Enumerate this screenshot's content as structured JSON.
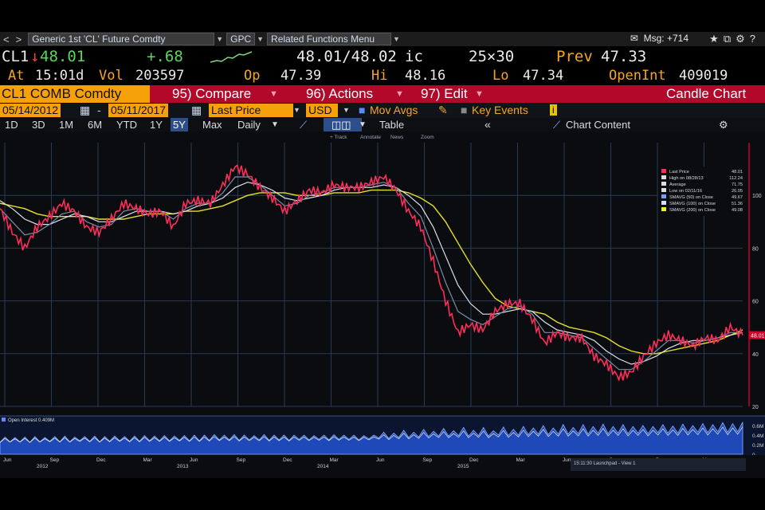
{
  "toolbar": {
    "back_glyph": "<",
    "fwd_glyph": ">",
    "security": "Generic 1st 'CL' Future Comdty",
    "function": "GPC",
    "related": "Related Functions Menu",
    "msg": "Msg: +714",
    "icons": [
      "mail-icon",
      "star-icon",
      "export-icon",
      "settings-icon",
      "help-icon"
    ]
  },
  "quote": {
    "ticker": "CL1",
    "arrow": "↓",
    "last": "48.01",
    "change": "+.68",
    "bid_ask": "48.01/48.02",
    "bid_ask_suffix": "ic",
    "size": "25×30",
    "prev_label": "Prev",
    "prev": "47.33",
    "at_label": "At",
    "time": "15:01d",
    "vol_label": "Vol",
    "vol": "203597",
    "op_label": "Op",
    "op": "47.39",
    "hi_label": "Hi",
    "hi": "48.16",
    "lo_label": "Lo",
    "lo": "47.34",
    "oi_label": "OpenInt",
    "oi": "409019"
  },
  "menu": {
    "ticker": "CL1 COMB Comdty",
    "compare": "95) Compare",
    "actions": "96) Actions",
    "edit": "97) Edit",
    "chart_type": "Candle Chart"
  },
  "options": {
    "start": "05/14/2012",
    "end": "05/11/2017",
    "field": "Last Price",
    "currency": "USD",
    "mov_avgs": "Mov Avgs",
    "key_events": "Key Events"
  },
  "ranges": {
    "items": [
      "1D",
      "3D",
      "1M",
      "6M",
      "YTD",
      "1Y",
      "5Y",
      "Max"
    ],
    "selected": "5Y",
    "period": "Daily",
    "table": "Table",
    "chart_content": "Chart Content"
  },
  "tools": [
    "+ Track",
    "Annotate",
    "News",
    "Zoom"
  ],
  "legend": [
    {
      "label": "Last Price",
      "value": "48.01",
      "color": "#ff2d5a"
    },
    {
      "label": "High on 08/28/13",
      "value": "112.24",
      "color": "#dddddd"
    },
    {
      "label": "Average",
      "value": "71.75",
      "color": "#dddddd"
    },
    {
      "label": "Low on 02/11/16",
      "value": "26.05",
      "color": "#dddddd"
    },
    {
      "label": "SMAVG (50) on Close",
      "value": "49.67",
      "color": "#7aa0ff"
    },
    {
      "label": "SMAVG (100) on Close",
      "value": "51.36",
      "color": "#cfe2ff"
    },
    {
      "label": "SMAVG (200) on Close",
      "value": "49.08",
      "color": "#f0f020"
    }
  ],
  "colors": {
    "price": "#ff2d5a",
    "ma50": "#7a8ca8",
    "ma100": "#d9e4ee",
    "ma200": "#e8e02a",
    "menubar": "#b2082a",
    "ticker_box": "#f7a10a",
    "oi_fill": "#1f49b8"
  },
  "chart_data": {
    "type": "line",
    "ylim": [
      20,
      120
    ],
    "y_ticks": [
      20,
      40,
      60,
      80,
      100
    ],
    "x_month_labels": [
      "Jun",
      "Sep",
      "Dec",
      "Mar",
      "Jun",
      "Sep",
      "Dec",
      "Mar",
      "Jun",
      "Sep",
      "Dec",
      "Mar",
      "Jun",
      "Sep",
      "Dec",
      "Mar"
    ],
    "x_year_labels": [
      "2012",
      "2013",
      "2014",
      "2015"
    ],
    "last_price_tag": "48.01",
    "x": [
      0,
      1,
      2,
      3,
      4,
      5,
      6,
      7,
      8,
      9,
      10,
      11,
      12,
      13,
      14,
      15,
      16,
      17,
      18,
      19,
      20,
      21,
      22,
      23,
      24,
      25,
      26,
      27,
      28,
      29,
      30,
      31,
      32,
      33,
      34,
      35,
      36,
      37,
      38,
      39,
      40,
      41,
      42,
      43,
      44,
      45,
      46,
      47,
      48,
      49,
      50,
      51,
      52,
      53,
      54,
      55,
      56,
      57,
      58,
      59,
      60
    ],
    "series": [
      {
        "name": "Last Price",
        "values": [
          95,
          86,
          80,
          88,
          92,
          97,
          94,
          88,
          86,
          91,
          97,
          95,
          93,
          94,
          88,
          97,
          98,
          97,
          104,
          111,
          108,
          103,
          99,
          94,
          98,
          102,
          101,
          104,
          103,
          103,
          105,
          107,
          102,
          94,
          88,
          75,
          60,
          48,
          51,
          49,
          56,
          59,
          59,
          53,
          44,
          48,
          46,
          46,
          39,
          36,
          31,
          33,
          39,
          44,
          47,
          45,
          43,
          46,
          45,
          50,
          47
        ]
      },
      {
        "name": "SMAVG (50) on Close",
        "values": [
          95,
          90,
          85,
          86,
          89,
          93,
          94,
          90,
          88,
          89,
          94,
          95,
          94,
          94,
          91,
          95,
          97,
          97,
          101,
          107,
          107,
          104,
          100,
          96,
          97,
          100,
          101,
          103,
          103,
          103,
          104,
          105,
          103,
          97,
          92,
          80,
          67,
          56,
          53,
          51,
          54,
          57,
          58,
          55,
          48,
          48,
          47,
          46,
          42,
          38,
          34,
          34,
          37,
          41,
          45,
          45,
          44,
          45,
          46,
          48,
          48
        ]
      },
      {
        "name": "SMAVG (100) on Close",
        "values": [
          98,
          95,
          91,
          89,
          89,
          91,
          93,
          92,
          90,
          90,
          92,
          94,
          94,
          94,
          93,
          94,
          96,
          97,
          99,
          103,
          105,
          104,
          102,
          99,
          98,
          99,
          100,
          102,
          103,
          103,
          103,
          104,
          103,
          100,
          96,
          88,
          77,
          66,
          59,
          55,
          55,
          56,
          57,
          56,
          52,
          49,
          48,
          47,
          45,
          41,
          38,
          36,
          37,
          39,
          42,
          44,
          45,
          45,
          46,
          47,
          48
        ]
      },
      {
        "name": "SMAVG (200) on Close",
        "values": [
          97,
          96,
          95,
          93,
          92,
          92,
          92,
          92,
          91,
          91,
          91,
          92,
          93,
          93,
          93,
          94,
          94,
          95,
          96,
          98,
          100,
          101,
          101,
          101,
          100,
          100,
          100,
          101,
          101,
          101,
          102,
          102,
          102,
          101,
          99,
          96,
          90,
          82,
          74,
          67,
          61,
          58,
          57,
          56,
          55,
          52,
          50,
          49,
          48,
          46,
          43,
          41,
          40,
          40,
          41,
          42,
          43,
          44,
          45,
          47,
          49
        ]
      }
    ],
    "open_interest": {
      "label": "Open Interest",
      "value": "0.409M",
      "y_ticks": [
        "0.6M",
        "0.4M",
        "0.2M",
        "0"
      ],
      "ylim": [
        0,
        0.7
      ],
      "values": [
        0.25,
        0.36,
        0.26,
        0.35,
        0.26,
        0.36,
        0.25,
        0.37,
        0.26,
        0.35,
        0.27,
        0.37,
        0.26,
        0.38,
        0.26,
        0.36,
        0.28,
        0.37,
        0.27,
        0.38,
        0.26,
        0.37,
        0.27,
        0.38,
        0.28,
        0.37,
        0.27,
        0.38,
        0.27,
        0.39,
        0.28,
        0.38,
        0.28,
        0.39,
        0.28,
        0.38,
        0.29,
        0.39,
        0.28,
        0.4,
        0.28,
        0.4,
        0.29,
        0.41,
        0.3,
        0.4,
        0.3,
        0.41,
        0.29,
        0.4,
        0.3,
        0.39,
        0.3,
        0.41,
        0.29,
        0.4,
        0.3,
        0.4,
        0.29,
        0.4,
        0.31,
        0.4,
        0.3,
        0.39,
        0.31,
        0.4,
        0.3,
        0.41,
        0.31,
        0.4,
        0.31,
        0.4,
        0.3,
        0.39,
        0.32,
        0.4,
        0.34,
        0.46,
        0.33,
        0.44,
        0.35,
        0.5,
        0.35,
        0.46,
        0.36,
        0.52,
        0.37,
        0.48,
        0.38,
        0.54,
        0.38,
        0.49,
        0.39,
        0.56,
        0.38,
        0.5,
        0.39,
        0.56,
        0.38,
        0.49,
        0.4,
        0.57,
        0.39,
        0.52,
        0.4,
        0.58,
        0.41,
        0.55,
        0.42,
        0.6,
        0.41,
        0.55,
        0.42,
        0.62,
        0.42,
        0.56,
        0.43,
        0.62,
        0.42,
        0.58,
        0.44,
        0.63,
        0.43,
        0.58,
        0.44,
        0.62,
        0.43,
        0.58,
        0.44,
        0.6,
        0.43,
        0.58,
        0.45,
        0.62,
        0.44,
        0.59,
        0.44,
        0.63,
        0.45,
        0.6,
        0.46,
        0.64,
        0.45,
        0.62,
        0.47,
        0.66,
        0.46,
        0.64,
        0.47,
        0.67
      ]
    }
  },
  "axis_label_price": "Last Price",
  "launchpad": "15:11:30 Launchpad - View 1"
}
